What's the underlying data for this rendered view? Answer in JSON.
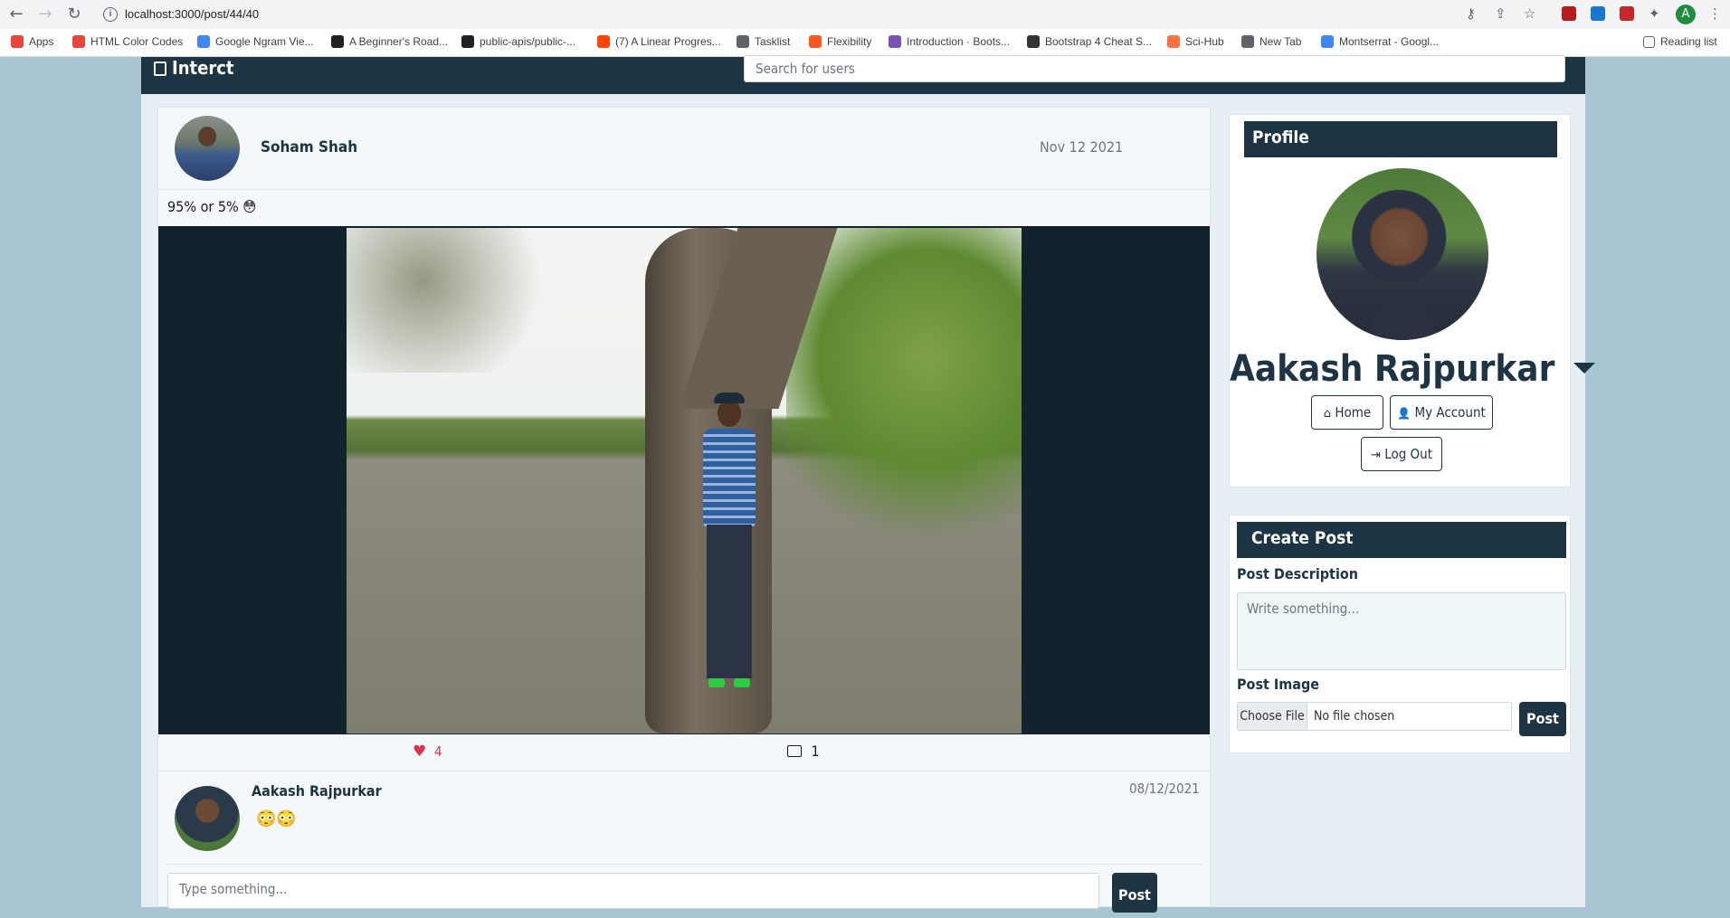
{
  "browser": {
    "url": "localhost:3000/post/44/40",
    "bookmarks": [
      {
        "label": "Apps",
        "color": "#e8453c"
      },
      {
        "label": "HTML Color Codes",
        "color": "#e8453c"
      },
      {
        "label": "Google Ngram Vie...",
        "color": "#4285f4"
      },
      {
        "label": "A Beginner's Road...",
        "color": "#202124"
      },
      {
        "label": "public-apis/public-...",
        "color": "#202124"
      },
      {
        "label": "(7) A Linear Progres...",
        "color": "#ff4500"
      },
      {
        "label": "Tasklist",
        "color": "#5f6368"
      },
      {
        "label": "Flexibility",
        "color": "#ff5722"
      },
      {
        "label": "Introduction · Boots...",
        "color": "#7952b3"
      },
      {
        "label": "Bootstrap 4 Cheat S...",
        "color": "#333333"
      },
      {
        "label": "Sci-Hub",
        "color": "#ff7043"
      },
      {
        "label": "New Tab",
        "color": "#5f6368"
      },
      {
        "label": "Montserrat - Googl...",
        "color": "#4285f4"
      }
    ],
    "reading_list": "Reading list",
    "profile_initial": "A"
  },
  "navbar": {
    "brand": "Interct",
    "search_placeholder": "Search for users"
  },
  "post": {
    "author": "Soham Shah",
    "date": "Nov 12 2021",
    "caption": "95% or 5% 😳",
    "likes": "4",
    "comments": "1"
  },
  "comment": {
    "author": "Aakash Rajpurkar",
    "date": "08/12/2021",
    "text": "😳😳"
  },
  "comment_form": {
    "placeholder": "Type something...",
    "button": "Post"
  },
  "profile": {
    "header": "Profile",
    "name": "Aakash Rajpurkar",
    "home": "Home",
    "my_account": "My Account",
    "logout": "Log Out"
  },
  "create_post": {
    "header": "Create Post",
    "desc_label": "Post Description",
    "desc_placeholder": "Write something...",
    "image_label": "Post Image",
    "choose_file": "Choose File",
    "no_file": "No file chosen",
    "button": "Post"
  },
  "colors": {
    "navy": "#1d3445",
    "like_red": "#dc3545",
    "page_bg": "#a9c4d2"
  }
}
